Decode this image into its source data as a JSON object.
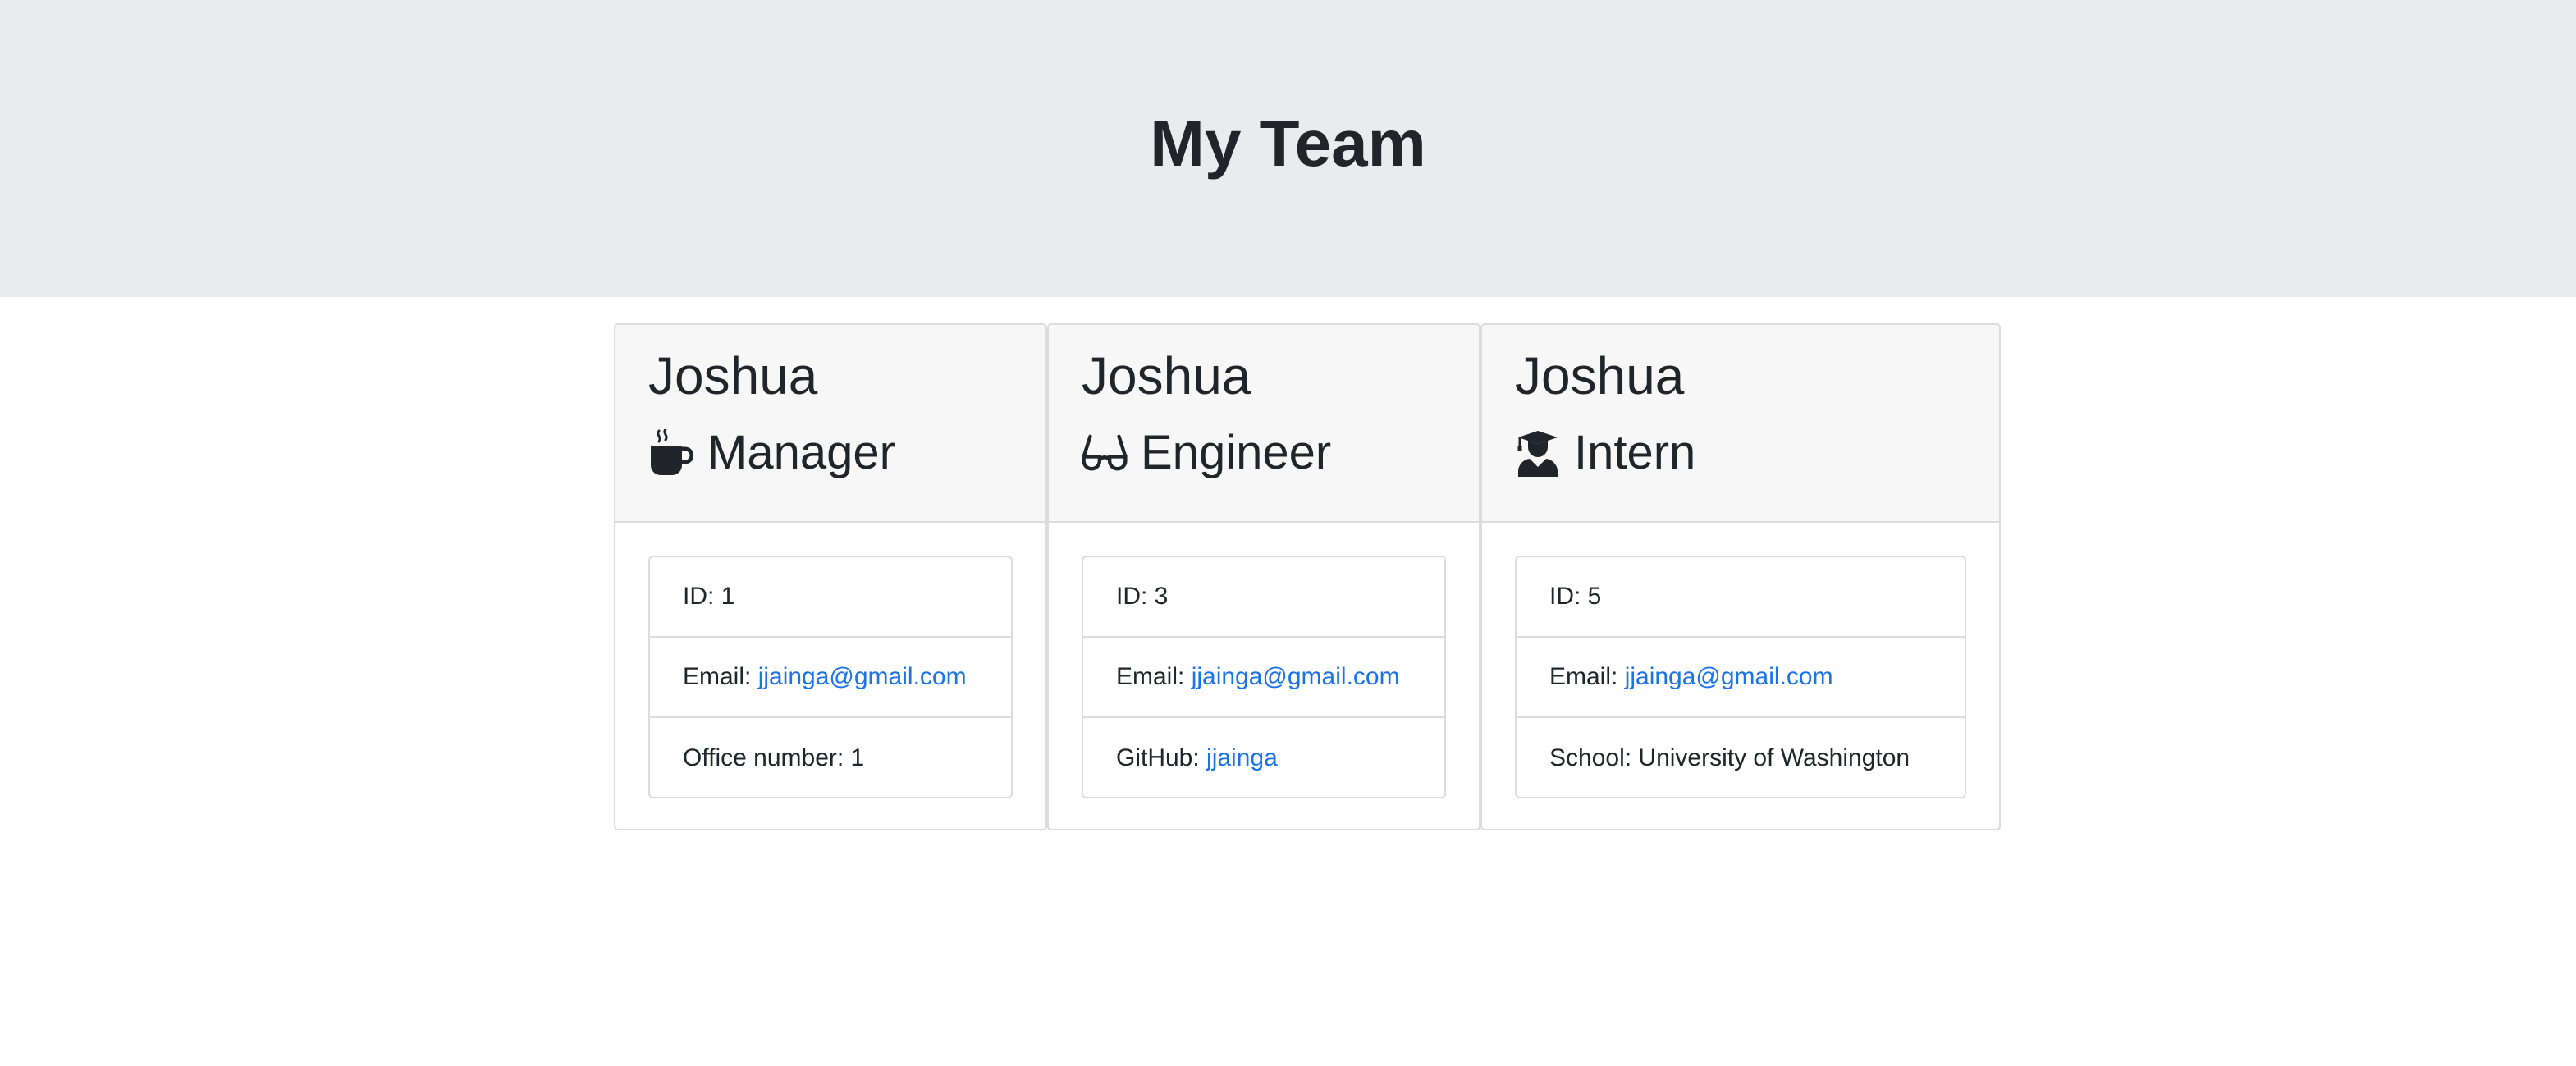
{
  "page": {
    "title": "My Team"
  },
  "cards": [
    {
      "name": "Joshua",
      "role": "Manager",
      "icon": "mug-icon",
      "id_label": "ID: 1",
      "email_prefix": "Email: ",
      "email": "jjainga@gmail.com",
      "extra_prefix": "Office number: 1"
    },
    {
      "name": "Joshua",
      "role": "Engineer",
      "icon": "glasses-icon",
      "id_label": "ID: 3",
      "email_prefix": "Email: ",
      "email": "jjainga@gmail.com",
      "extra_prefix": "GitHub: ",
      "extra_link": "jjainga"
    },
    {
      "name": "Joshua",
      "role": "Intern",
      "icon": "graduate-icon",
      "id_label": "ID: 5",
      "email_prefix": "Email: ",
      "email": "jjainga@gmail.com",
      "extra_prefix": "School: University of Washington"
    }
  ],
  "colors": {
    "header_bg": "#e9ecef",
    "card_header_bg": "#f7f7f7",
    "link": "#1a73e8",
    "text": "#212529"
  }
}
